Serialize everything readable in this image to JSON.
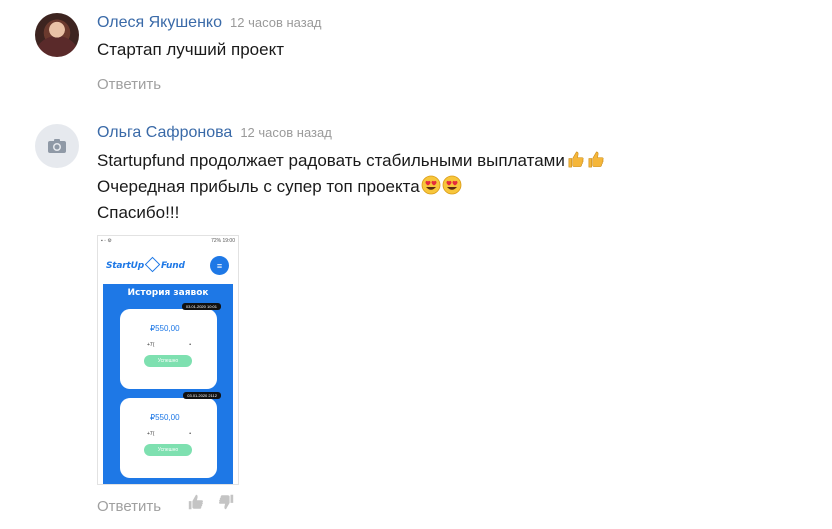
{
  "comments": [
    {
      "author": "Олеся Якушенко",
      "time": "12 часов назад",
      "lines": [
        "Стартап лучший проект"
      ],
      "reply_label": "Ответить"
    },
    {
      "author": "Ольга Сафронова",
      "time": "12 часов назад",
      "lines": [
        "Startupfund продолжает радовать стабильными выплатами",
        "Очередная прибыль с супер топ проекта",
        "Спасибо!!!"
      ],
      "emoji_line1": [
        "thumbs-up",
        "thumbs-up"
      ],
      "emoji_line2": [
        "heart-eyes",
        "heart-eyes"
      ],
      "reply_label": "Ответить",
      "attachment": {
        "status_right": "72% 19:00",
        "logo_left": "StartUp",
        "logo_right": "Fund",
        "panel_title": "История заявок",
        "cards": [
          {
            "date": "03.01.2020 10:01",
            "amount": "₽550,00",
            "row_left": "+7(",
            "row_right": "•",
            "status": "Успешно"
          },
          {
            "date": "03.01.2020 2112",
            "amount": "₽550,00",
            "row_left": "+7(",
            "row_right": "•",
            "status": "Успешно"
          }
        ]
      }
    }
  ],
  "colors": {
    "accent": "#1e78e6",
    "author": "#3a6aa8",
    "muted": "#a0a0a0",
    "success": "#7ee0b0"
  }
}
